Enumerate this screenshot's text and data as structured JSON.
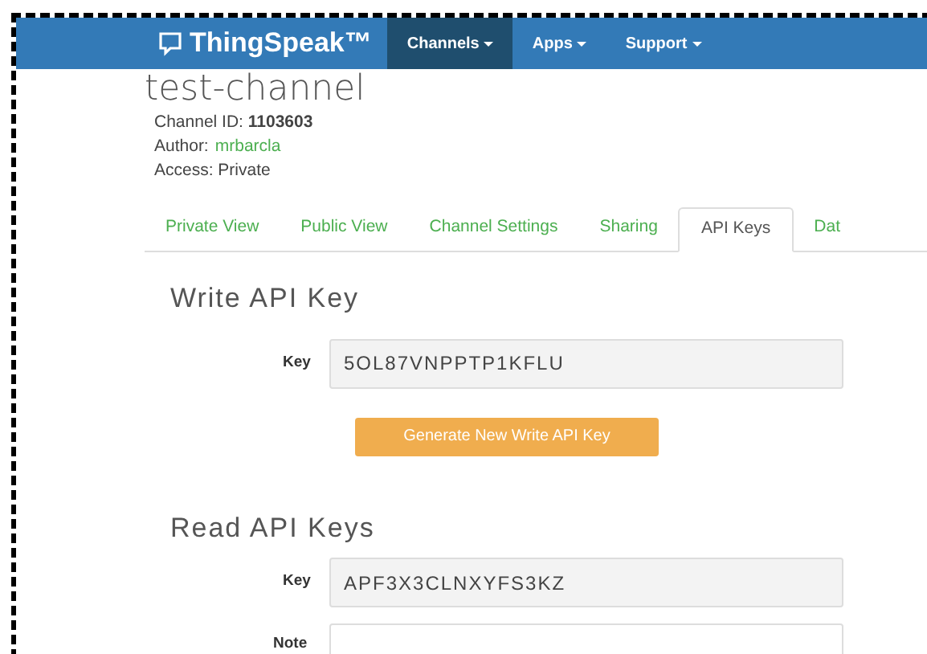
{
  "navbar": {
    "logo": "ThingSpeak™",
    "menu": [
      {
        "label": "Channels",
        "selected": true
      },
      {
        "label": "Apps",
        "selected": false
      },
      {
        "label": "Support",
        "selected": false
      }
    ]
  },
  "channel": {
    "title": "test-channel",
    "id_label": "Channel ID:",
    "id": "1103603",
    "author_label": "Author:",
    "author": "mrbarcla",
    "access": "Access: Private"
  },
  "tabs": [
    {
      "label": "Private View",
      "selected": false
    },
    {
      "label": "Public View",
      "selected": false
    },
    {
      "label": "Channel Settings",
      "selected": false
    },
    {
      "label": "Sharing",
      "selected": false
    },
    {
      "label": "API Keys",
      "selected": true
    },
    {
      "label": "Dat",
      "selected": false
    }
  ],
  "write_section": {
    "heading": "Write API Key",
    "key_label": "Key",
    "key": "5OL87VNPPTP1KFLU",
    "button": "Generate New Write API Key"
  },
  "read_section": {
    "heading": "Read API Keys",
    "key_label": "Key",
    "key": "APF3X3CLNXYFS3KZ",
    "note_label": "Note"
  }
}
